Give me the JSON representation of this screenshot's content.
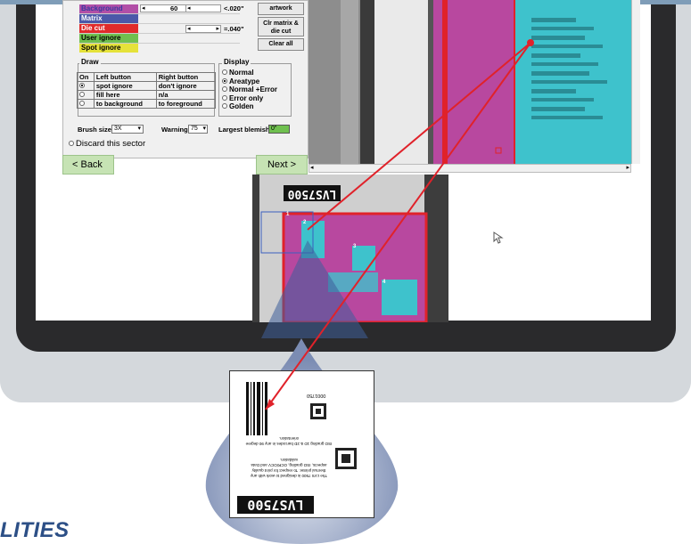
{
  "layers": [
    {
      "label": "Background",
      "bg": "#b24fa7",
      "fg": "#3a3aa0"
    },
    {
      "label": "Matrix",
      "bg": "#4b58a9",
      "fg": "#ffffff"
    },
    {
      "label": "Die cut",
      "bg": "#e02b2b",
      "fg": "#ffffff"
    },
    {
      "label": "User ignore",
      "bg": "#6fc04f",
      "fg": "#000000"
    },
    {
      "label": "Spot ignore",
      "bg": "#e5e23a",
      "fg": "#000000"
    }
  ],
  "tolerance": {
    "value1": "60",
    "value2": "<.020\"",
    "value3": "=.040\""
  },
  "buttons": {
    "artwork": "artwork",
    "clr_matrix": "Clr matrix & die cut",
    "clear_all": "Clear all",
    "back": "< Back",
    "next": "Next >"
  },
  "draw": {
    "title": "Draw",
    "headers": [
      "On",
      "Left button",
      "Right button"
    ],
    "rows": [
      {
        "left": "spot ignore",
        "right": "don't ignore",
        "selected": true
      },
      {
        "left": "fill here",
        "right": "n/a",
        "selected": false
      },
      {
        "left": "to background",
        "right": "to foreground",
        "selected": false
      }
    ]
  },
  "display": {
    "title": "Display",
    "options": [
      {
        "label": "Normal",
        "selected": false
      },
      {
        "label": "Areatype",
        "selected": true
      },
      {
        "label": "Normal +Error",
        "selected": false
      },
      {
        "label": "Error only",
        "selected": false
      },
      {
        "label": "Golden",
        "selected": false
      }
    ]
  },
  "brush": {
    "label": "Brush size",
    "value": "3X"
  },
  "warning": {
    "label": "Warning",
    "value": "75"
  },
  "blemish": {
    "label": "Largest blemish",
    "value": "0\""
  },
  "discard": {
    "label": "Discard this sector"
  },
  "preview": {
    "label_text": "LVS7500",
    "regions": [
      "1",
      "2",
      "3",
      "4"
    ]
  },
  "card": {
    "label_text": "LVS7500",
    "number": "0001750",
    "body": "The LVS 7500 is designed to work with any thermal printer. To respect for print quality aspects, ISO grading, OCR/OCV and Data validation.",
    "footer": "ISO grading 1D & 2D barcodes in any 90 degree orientation."
  },
  "footer": {
    "text": "LITIES"
  },
  "colors": {
    "magenta": "#b8489f",
    "cyan": "#3ec2cc",
    "red": "#e0222a",
    "green_btn": "#c6e3b4",
    "navy": "#2c4f86"
  }
}
